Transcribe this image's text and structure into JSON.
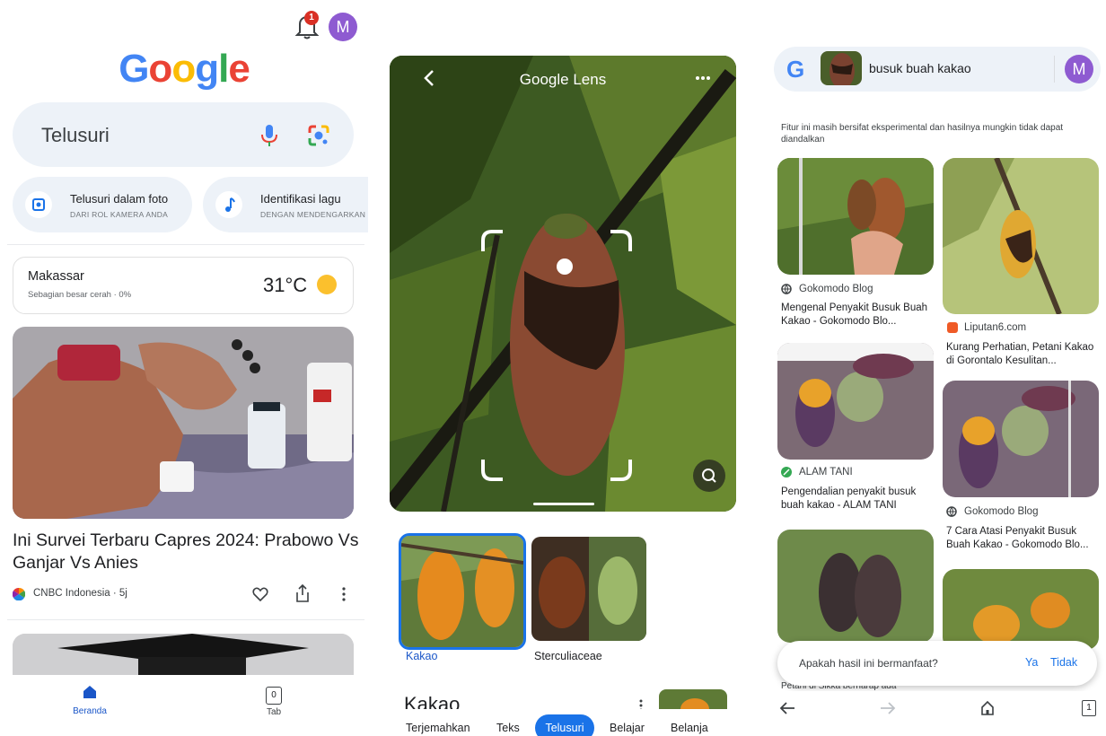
{
  "home": {
    "notification_count": "1",
    "avatar_letter": "M",
    "logo": [
      "G",
      "o",
      "o",
      "g",
      "l",
      "e"
    ],
    "search_placeholder": "Telusuri",
    "chips": [
      {
        "title": "Telusuri dalam foto",
        "subtitle": "DARI ROL KAMERA ANDA"
      },
      {
        "title": "Identifikasi lagu",
        "subtitle": "DENGAN MENDENGARKAN"
      }
    ],
    "weather": {
      "city": "Makassar",
      "desc": "Sebagian besar cerah · 0%",
      "temp": "31°C"
    },
    "news": {
      "headline": "Ini Survei Terbaru Capres 2024: Prabowo Vs Ganjar Vs Anies",
      "source": "CNBC Indonesia · 5j"
    },
    "bottom_nav": [
      {
        "label": "Beranda",
        "icon": "home-icon"
      },
      {
        "label": "Tab",
        "icon": "tab-icon",
        "count": "0"
      }
    ]
  },
  "lens": {
    "title": "Google Lens",
    "results": [
      {
        "label": "Kakao"
      },
      {
        "label": "Sterculiaceae"
      }
    ],
    "section_heading": "Kakao",
    "tabs": [
      {
        "label": "Terjemahkan",
        "active": false
      },
      {
        "label": "Teks",
        "active": false
      },
      {
        "label": "Telusuri",
        "active": true
      },
      {
        "label": "Belajar",
        "active": false
      },
      {
        "label": "Belanja",
        "active": false
      }
    ]
  },
  "results": {
    "query": "busuk buah kakao",
    "avatar_letter": "M",
    "notice": "Fitur ini masih bersifat eksperimental dan hasilnya mungkin tidak dapat diandalkan",
    "left_column": [
      {
        "source": "Gokomodo Blog",
        "title": "Mengenal Penyakit Busuk Buah Kakao - Gokomodo Blo..."
      },
      {
        "source": "ALAM TANI",
        "title": "Pengendalian penyakit busuk buah kakao - ALAM TANI"
      },
      {
        "title_partial": "Petani di Sikka berharap ada"
      }
    ],
    "right_column": [
      {
        "source": "Liputan6.com",
        "title": "Kurang Perhatian, Petani Kakao di Gorontalo Kesulitan..."
      },
      {
        "source": "Gokomodo Blog",
        "title": "7 Cara Atasi Penyakit Busuk Buah Kakao - Gokomodo Blo..."
      }
    ],
    "feedback": {
      "question": "Apakah hasil ini bermanfaat?",
      "yes": "Ya",
      "no": "Tidak"
    },
    "browser_tab_count": "1"
  },
  "colors": {
    "google_blue": "#4285f4",
    "google_red": "#ea4335",
    "google_yellow": "#fbbc05",
    "google_green": "#34a853",
    "active_tab": "#1a73e8",
    "avatar": "#8e5bd1"
  }
}
